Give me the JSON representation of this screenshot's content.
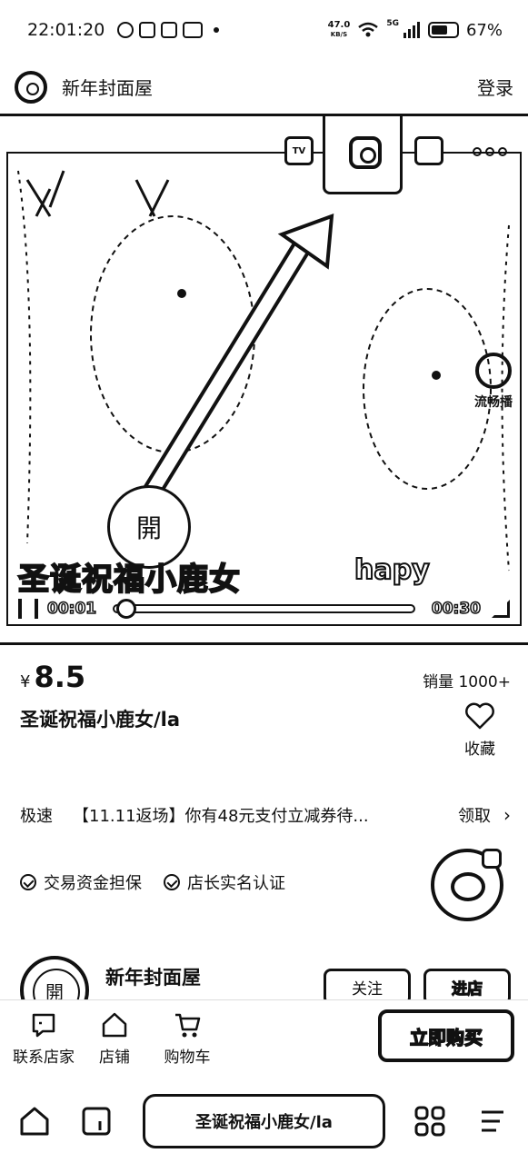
{
  "status_bar": {
    "time": "22:01:20",
    "net_speed_value": "47.0",
    "net_speed_unit": "KB/S",
    "network": "5G",
    "battery": "67%",
    "battery_level": 0.67
  },
  "header": {
    "shop_title": "新年封面屋",
    "login_label": "登录"
  },
  "media": {
    "tv_label": "TV",
    "caption_left": "圣诞祝福小鹿女",
    "caption_right": "hapy",
    "play_overlay_char": "開",
    "fluent_label": "流畅播",
    "time_current": "00:01",
    "time_total": "00:30",
    "progress": 0.03
  },
  "product": {
    "currency": "¥",
    "price": "8.5",
    "sales": "销量 1000+",
    "title": "圣诞祝福小鹿女/la",
    "favorite_label": "收藏"
  },
  "promo": {
    "tag": "极速",
    "text": "【11.11返场】你有48元支付立减券待...",
    "claim_label": "领取",
    "chevron": "›"
  },
  "guarantees": [
    {
      "label": "交易资金担保"
    },
    {
      "label": "店长实名认证"
    }
  ],
  "shop": {
    "avatar_char": "開",
    "name": "新年封面屋",
    "follow_label": "关注",
    "enter_label": "进店"
  },
  "action_bar": {
    "contact_label": "联系店家",
    "store_label": "店铺",
    "cart_label": "购物车",
    "buy_label": "立即购买"
  },
  "nav_bar": {
    "url_text": "圣诞祝福小鹿女/la"
  }
}
